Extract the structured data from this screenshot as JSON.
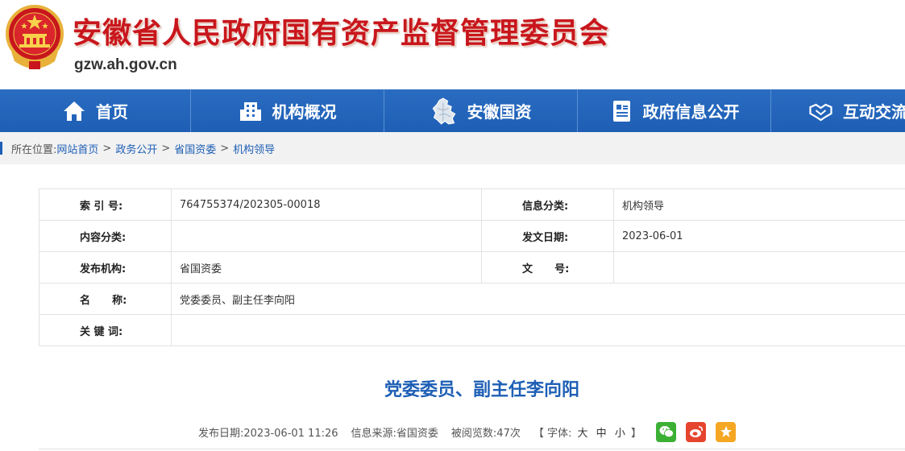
{
  "header": {
    "title": "安徽省人民政府国有资产监督管理委员会",
    "domain": "gzw.ah.gov.cn"
  },
  "nav": {
    "items": [
      {
        "label": "首页",
        "icon": "home-icon"
      },
      {
        "label": "机构概况",
        "icon": "building-icon"
      },
      {
        "label": "安徽国资",
        "icon": "map-icon"
      },
      {
        "label": "政府信息公开",
        "icon": "document-icon"
      },
      {
        "label": "互动交流",
        "icon": "handshake-icon"
      }
    ]
  },
  "breadcrumb": {
    "prefix": "所在位置:",
    "items": [
      "网站首页",
      "政务公开",
      "省国资委",
      "机构领导"
    ],
    "separator": ">"
  },
  "info": {
    "index_label": "索 引 号:",
    "index_value": "764755374/202305-00018",
    "category_label": "信息分类:",
    "category_value": "机构领导",
    "content_label": "内容分类:",
    "content_value": "",
    "date_label": "发文日期:",
    "date_value": "2023-06-01",
    "org_label": "发布机构:",
    "org_value": "省国资委",
    "docno_label": "文      号:",
    "docno_value": "",
    "name_label": "名      称:",
    "name_value": "党委委员、副主任李向阳",
    "keywords_label": "关 键 词:",
    "keywords_value": ""
  },
  "article": {
    "title": "党委委员、副主任李向阳"
  },
  "meta": {
    "publish": "发布日期:2023-06-01 11:26",
    "source": "信息来源:省国资委",
    "views": "被阅览数:47次",
    "font_prefix": "【 字体:",
    "font_large": "大",
    "font_medium": "中",
    "font_small": "小",
    "font_suffix": "】"
  },
  "colors": {
    "brand_red": "#c8161d",
    "nav_blue": "#1e5fb5",
    "link_blue": "#1e5fb5"
  }
}
